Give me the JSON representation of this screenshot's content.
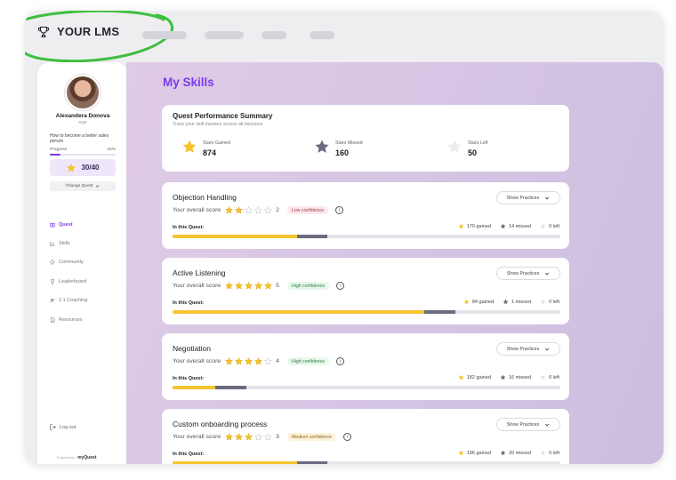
{
  "app": {
    "logo_text": "YOUR LMS"
  },
  "user": {
    "name": "Alexandera Donova",
    "role": "SQE",
    "goal": "How to become a better sales person",
    "progress_label": "Progress",
    "progress_pct_text": "16%",
    "progress_fraction": 0.16,
    "stars_text": "30/40",
    "change_quest_label": "Change Quest"
  },
  "nav": {
    "items": [
      {
        "label": "Quest",
        "icon": "quest-icon",
        "active": true
      },
      {
        "label": "Skills",
        "icon": "skills-icon",
        "active": false
      },
      {
        "label": "Community",
        "icon": "community-icon",
        "active": false
      },
      {
        "label": "Leaderboard",
        "icon": "trophy-icon",
        "active": false
      },
      {
        "label": "1:1 Coaching",
        "icon": "people-icon",
        "active": false
      },
      {
        "label": "Resources",
        "icon": "document-icon",
        "active": false
      }
    ],
    "logout_label": "Log out",
    "powered_by": "Powered by",
    "powered_brand": "myQuest"
  },
  "page": {
    "title": "My Skills"
  },
  "summary": {
    "title": "Quest Performance Summary",
    "subtitle": "Track your skill mastery across all missions",
    "stats": [
      {
        "label": "Stars Gained",
        "value": "874",
        "icon": "star-gold-icon"
      },
      {
        "label": "Stars Missed",
        "value": "160",
        "icon": "star-grey-icon"
      },
      {
        "label": "Stars Left",
        "value": "50",
        "icon": "star-light-icon"
      }
    ]
  },
  "skills_common": {
    "score_label": "Your overall score",
    "show_practices_label": "Show Practices",
    "in_quest_label": "In this Quest:"
  },
  "skills": [
    {
      "title": "Objection Handling",
      "stars": 2,
      "score": "2",
      "confidence": "Low confidence",
      "conf_level": "low",
      "gained": "170 gained",
      "missed": "14 missed",
      "left": "0 left",
      "gained_frac": 0.32,
      "missed_frac": 0.08
    },
    {
      "title": "Active Listening",
      "stars": 5,
      "score": "5",
      "confidence": "High confidence",
      "conf_level": "high",
      "gained": "84 gained",
      "missed": "1 missed",
      "left": "0 left",
      "gained_frac": 0.65,
      "missed_frac": 0.08
    },
    {
      "title": "Negotiation",
      "stars": 4,
      "score": "4",
      "confidence": "High confidence",
      "conf_level": "high",
      "gained": "182 gained",
      "missed": "16 missed",
      "left": "0 left",
      "gained_frac": 0.11,
      "missed_frac": 0.08
    },
    {
      "title": "Custom onboarding process",
      "stars": 3,
      "score": "3",
      "confidence": "Medium confidence",
      "conf_level": "medium",
      "gained": "196 gained",
      "missed": "20 missed",
      "left": "0 left",
      "gained_frac": 0.32,
      "missed_frac": 0.08
    }
  ],
  "colors": {
    "accent": "#7c3aed",
    "star": "#f5c531",
    "missed": "#6b6b80"
  }
}
